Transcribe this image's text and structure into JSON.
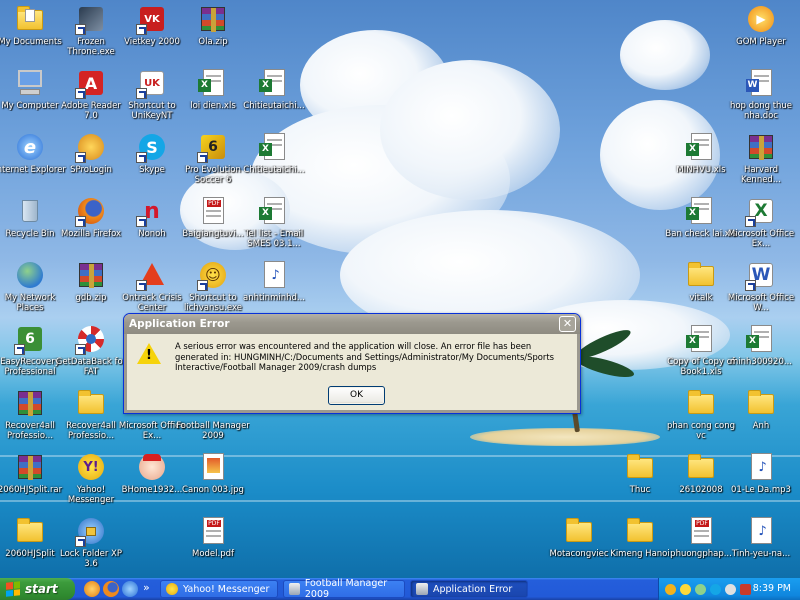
{
  "desktop": {
    "icons": [
      {
        "label": "My Documents",
        "icon": "folder-icon"
      },
      {
        "label": "Frozen Throne.exe",
        "icon": "game-icon"
      },
      {
        "label": "Vietkey 2000",
        "icon": "vietkey-icon"
      },
      {
        "label": "Ola.zip",
        "icon": "archive-icon"
      },
      {
        "label": "My Computer",
        "icon": "computer-icon"
      },
      {
        "label": "Adobe Reader 7.0",
        "icon": "pdf-app-icon"
      },
      {
        "label": "Shortcut to UniKeyNT",
        "icon": "unikey-icon"
      },
      {
        "label": "loi dien.xls",
        "icon": "excel-file-icon"
      },
      {
        "label": "Chitieutaichi...",
        "icon": "excel-file-icon"
      },
      {
        "label": "Internet Explorer",
        "icon": "ie-icon"
      },
      {
        "label": "SProLogin",
        "icon": "sprologin-icon"
      },
      {
        "label": "Skype",
        "icon": "skype-icon"
      },
      {
        "label": "Pro Evolution Soccer 6",
        "icon": "game-icon"
      },
      {
        "label": "Chitieutaichi...",
        "icon": "excel-file-icon"
      },
      {
        "label": "Recycle Bin",
        "icon": "recycle-bin-icon"
      },
      {
        "label": "Mozilla Firefox",
        "icon": "firefox-icon"
      },
      {
        "label": "Nonoh",
        "icon": "nonoh-icon"
      },
      {
        "label": "Baigiangtuvi...",
        "icon": "pdf-file-icon"
      },
      {
        "label": "Tel list - Email SMES 03.1...",
        "icon": "excel-file-icon"
      },
      {
        "label": "My Network Places",
        "icon": "network-icon"
      },
      {
        "label": "gdb.zip",
        "icon": "archive-icon"
      },
      {
        "label": "Ontrack Crisis Center",
        "icon": "warning-app-icon"
      },
      {
        "label": "Shortcut to lichvansu.exe",
        "icon": "smiley-icon"
      },
      {
        "label": "anhtinminhd...",
        "icon": "audio-file-icon"
      },
      {
        "label": "EasyRecovery Professional",
        "icon": "recovery-icon"
      },
      {
        "label": "GetDataBack for FAT",
        "icon": "lifebuoy-icon"
      },
      {
        "label": "Recover4all Professio...",
        "icon": "archive-icon"
      },
      {
        "label": "Recover4all Professio...",
        "icon": "folder-icon"
      },
      {
        "label": "Microsoft Office Ex...",
        "icon": "excel-app-icon"
      },
      {
        "label": "Football Manager 2009",
        "icon": "fm-icon"
      },
      {
        "label": "2060HJSplit.rar",
        "icon": "archive-icon"
      },
      {
        "label": "Yahoo! Messenger",
        "icon": "yahoo-icon"
      },
      {
        "label": "BHome1932...",
        "icon": "bhome-icon"
      },
      {
        "label": "Canon 003.jpg",
        "icon": "image-file-icon"
      },
      {
        "label": "2060HJSplit",
        "icon": "folder-icon"
      },
      {
        "label": "Lock Folder XP 3.6",
        "icon": "lock-icon"
      },
      {
        "label": "Model.pdf",
        "icon": "pdf-file-icon"
      },
      {
        "label": "GOM Player",
        "icon": "gom-icon"
      },
      {
        "label": "hop dong thue nha.doc",
        "icon": "word-file-icon"
      },
      {
        "label": "MINHVU.xls",
        "icon": "excel-file-icon"
      },
      {
        "label": "Harvard Kenned...",
        "icon": "archive-icon"
      },
      {
        "label": "Ban check lai.xls",
        "icon": "excel-file-icon"
      },
      {
        "label": "Microsoft Office Ex...",
        "icon": "excel-app-icon"
      },
      {
        "label": "vitalk",
        "icon": "folder-icon"
      },
      {
        "label": "Microsoft Office W...",
        "icon": "word-app-icon"
      },
      {
        "label": "Copy of Copy of Book1.xls",
        "icon": "excel-file-icon"
      },
      {
        "label": "minh300920...",
        "icon": "excel-file-icon"
      },
      {
        "label": "phan cong cong vc",
        "icon": "folder-icon"
      },
      {
        "label": "Anh",
        "icon": "folder-icon"
      },
      {
        "label": "Thuc",
        "icon": "folder-icon"
      },
      {
        "label": "26102008",
        "icon": "folder-icon"
      },
      {
        "label": "01-Le Da.mp3",
        "icon": "audio-file-icon"
      },
      {
        "label": "Motacongviec",
        "icon": "folder-icon"
      },
      {
        "label": "Kimeng Hanoi",
        "icon": "folder-icon"
      },
      {
        "label": "phuongphap...",
        "icon": "pdf-file-icon"
      },
      {
        "label": "Tinh-yeu-na...",
        "icon": "audio-file-icon"
      }
    ]
  },
  "dialog": {
    "title": "Application Error",
    "close_glyph": "✕",
    "message": "A serious error was encountered and the application will close. An error file has been generated in: HUNGMINH/C:/Documents and Settings/Administrator/My Documents/Sports Interactive/Football Manager 2009/crash dumps",
    "ok_label": "OK",
    "warning_glyph": "!"
  },
  "taskbar": {
    "start_label": "start",
    "chevron": "»",
    "tasks": [
      {
        "label": "Yahoo! Messenger",
        "icon": "yahoo-icon",
        "active": false
      },
      {
        "label": "Football Manager 2009",
        "icon": "fm-icon",
        "active": false
      },
      {
        "label": "Application Error",
        "icon": "window-icon",
        "active": true
      }
    ],
    "clock": "8:39 PM"
  }
}
